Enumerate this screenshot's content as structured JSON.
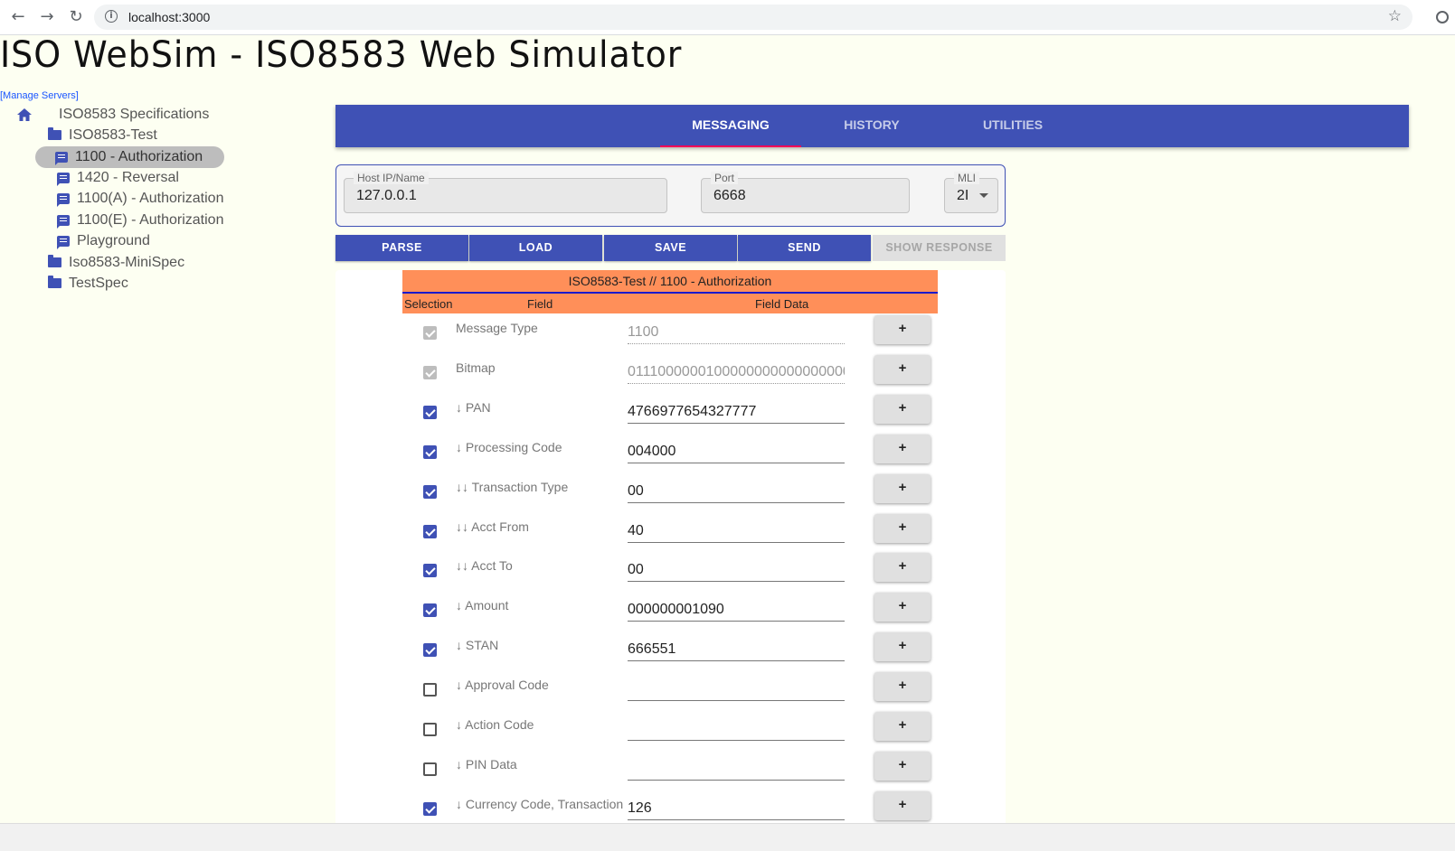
{
  "browser": {
    "url": "localhost:3000",
    "back_icon": "←",
    "forward_icon": "→",
    "reload_icon": "↻",
    "info_icon": "i",
    "star_icon": "☆"
  },
  "app": {
    "title": "ISO WebSim - ISO8583 Web Simulator",
    "manage_servers": "[Manage Servers]"
  },
  "tree": {
    "root": "ISO8583 Specifications",
    "folder1": "ISO8583-Test",
    "items": [
      "1100 - Authorization",
      "1420 - Reversal",
      "1100(A) - Authorization",
      "1100(E) - Authorization",
      "Playground"
    ],
    "folder2": "Iso8583-MiniSpec",
    "folder3": "TestSpec"
  },
  "tabs": [
    "MESSAGING",
    "HISTORY",
    "UTILITIES"
  ],
  "host": {
    "host_label": "Host IP/Name",
    "host_value": "127.0.0.1",
    "port_label": "Port",
    "port_value": "6668",
    "mli_label": "MLI",
    "mli_value": "2I"
  },
  "actions": [
    "PARSE",
    "LOAD",
    "SAVE",
    "SEND",
    "SHOW RESPONSE"
  ],
  "table": {
    "title": "ISO8583-Test // 1100 - Authorization",
    "col_selection": "Selection",
    "col_field": "Field",
    "col_data": "Field Data",
    "plus_label": "+",
    "rows": [
      {
        "name": "Message Type",
        "value": "1100",
        "state": "dis"
      },
      {
        "name": "Bitmap",
        "value": "0111000000100000000000000000",
        "state": "dis"
      },
      {
        "name": "↓ PAN",
        "value": "4766977654327777",
        "state": "on"
      },
      {
        "name": "↓ Processing Code",
        "value": "004000",
        "state": "on"
      },
      {
        "name": "↓↓ Transaction Type",
        "value": "00",
        "state": "on"
      },
      {
        "name": "↓↓ Acct From",
        "value": "40",
        "state": "on"
      },
      {
        "name": "↓↓ Acct To",
        "value": "00",
        "state": "on"
      },
      {
        "name": "↓ Amount",
        "value": "000000001090",
        "state": "on"
      },
      {
        "name": "↓ STAN",
        "value": "666551",
        "state": "on"
      },
      {
        "name": "↓ Approval Code",
        "value": "",
        "state": "off"
      },
      {
        "name": "↓ Action Code",
        "value": "",
        "state": "off"
      },
      {
        "name": "↓ PIN Data",
        "value": "",
        "state": "off"
      },
      {
        "name": "↓ Currency Code, Transaction",
        "value": "126",
        "state": "on"
      }
    ]
  }
}
